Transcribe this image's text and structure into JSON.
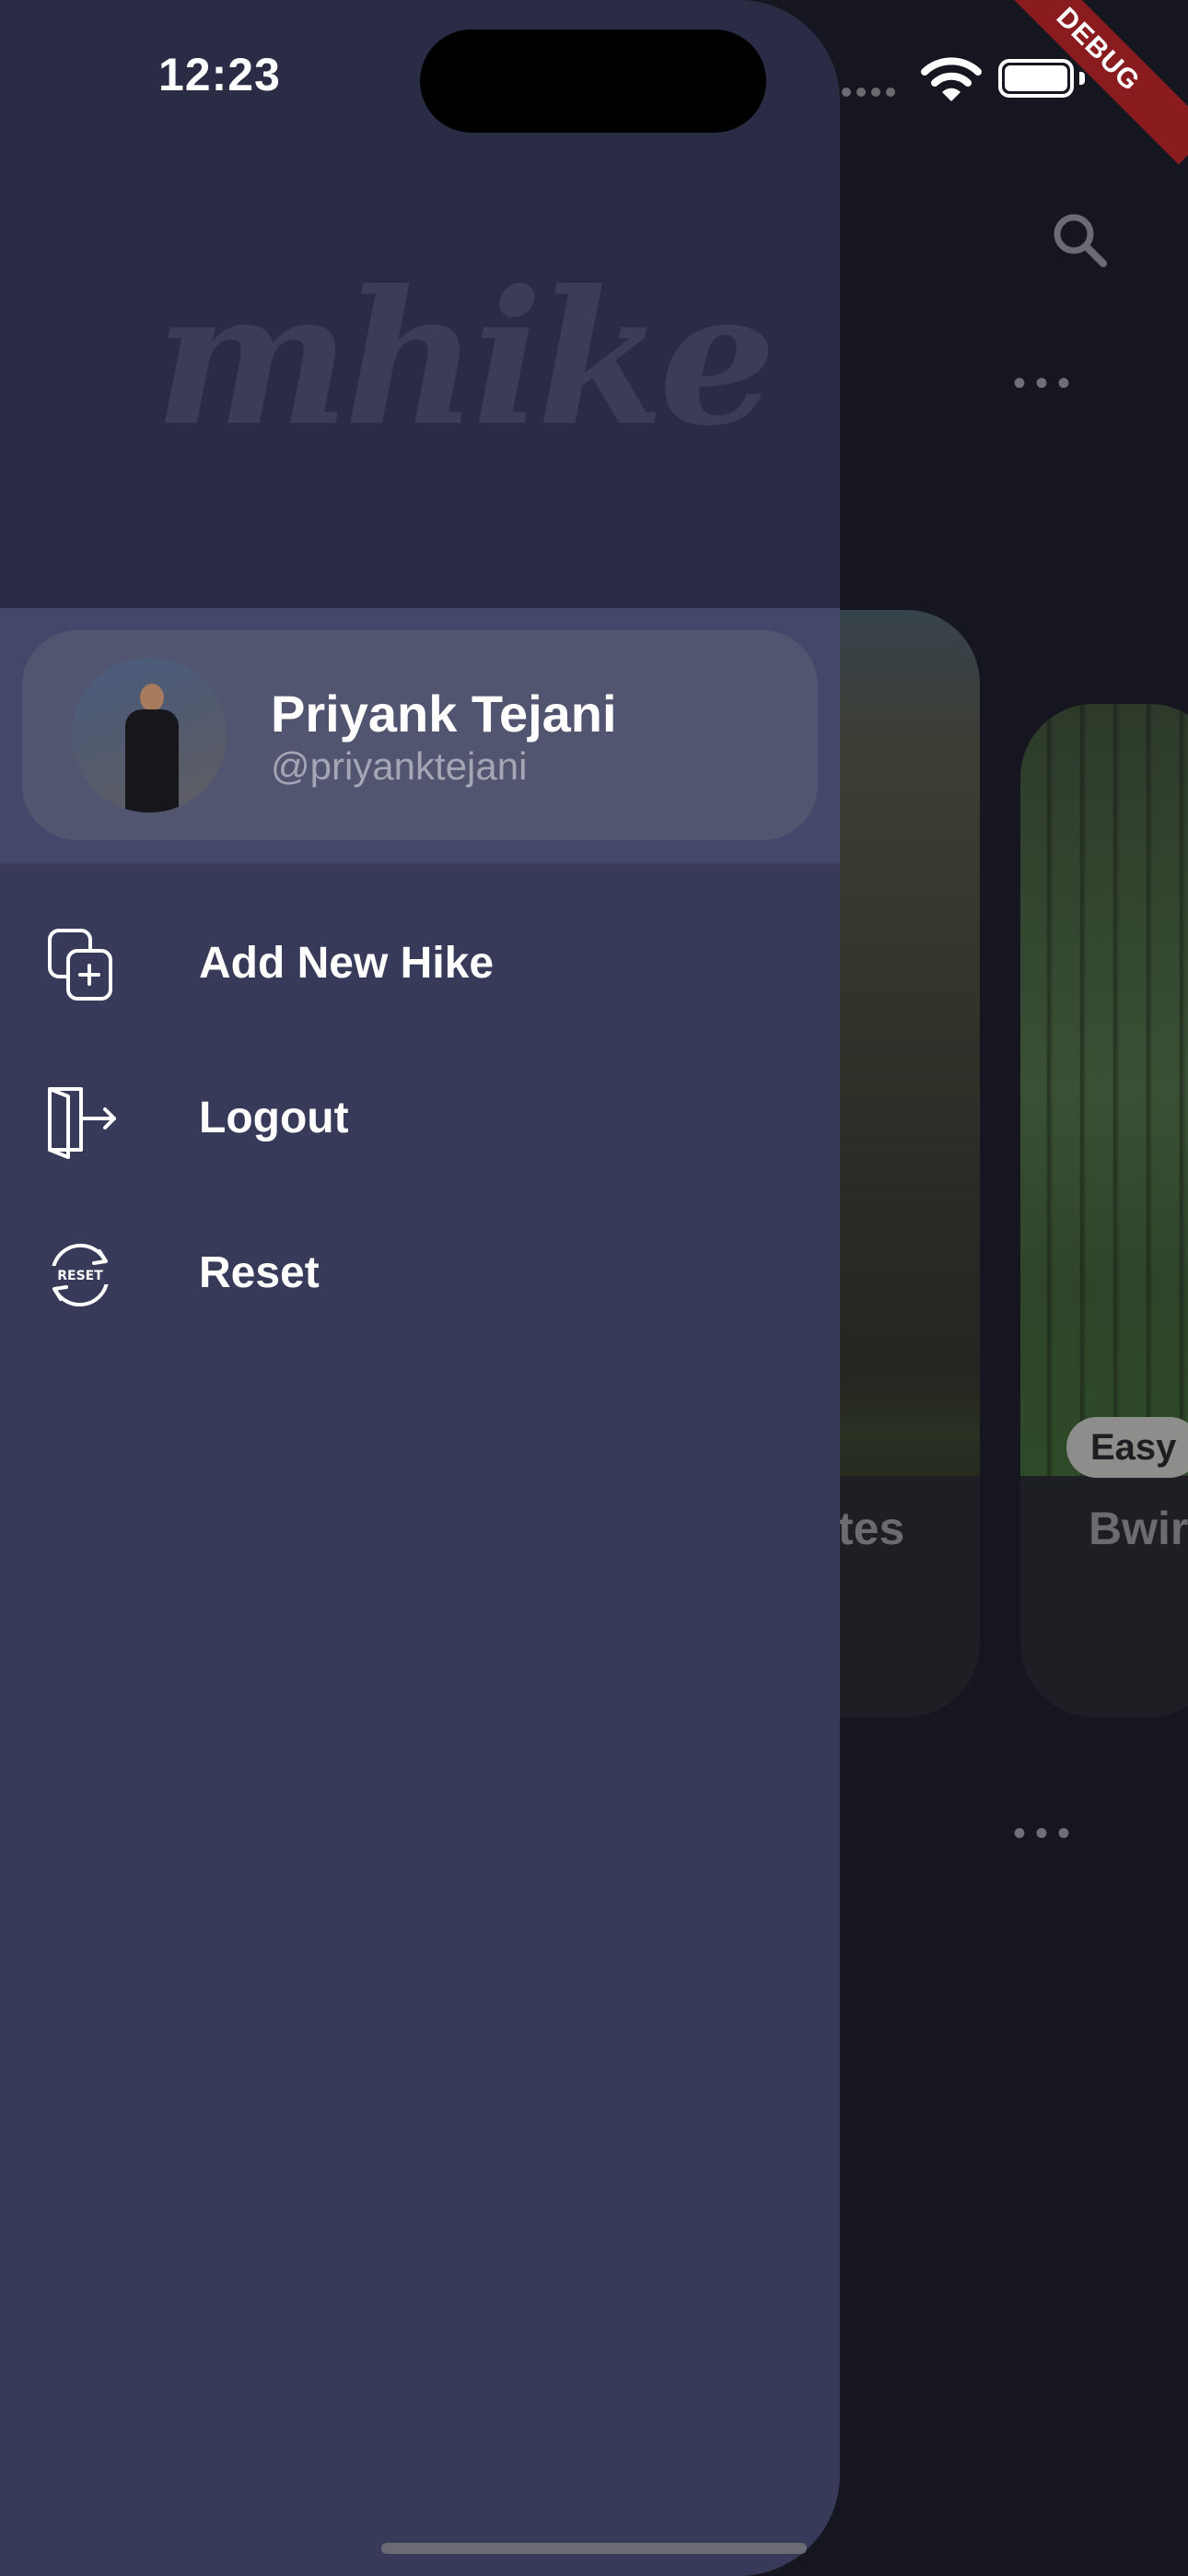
{
  "status_bar": {
    "time": "12:23"
  },
  "debug_banner": "DEBUG",
  "drawer": {
    "logo": "mhike",
    "profile": {
      "name": "Priyank Tejani",
      "handle": "@priyanktejani"
    },
    "menu": [
      {
        "label": "Add New Hike",
        "icon": "add-copy-icon"
      },
      {
        "label": "Logout",
        "icon": "logout-door-icon"
      },
      {
        "label": "Reset",
        "icon": "reset-icon"
      }
    ]
  },
  "background": {
    "card1_title_partial": "tes",
    "card2_title_partial": "Bwir",
    "card2_badge": "Easy"
  }
}
